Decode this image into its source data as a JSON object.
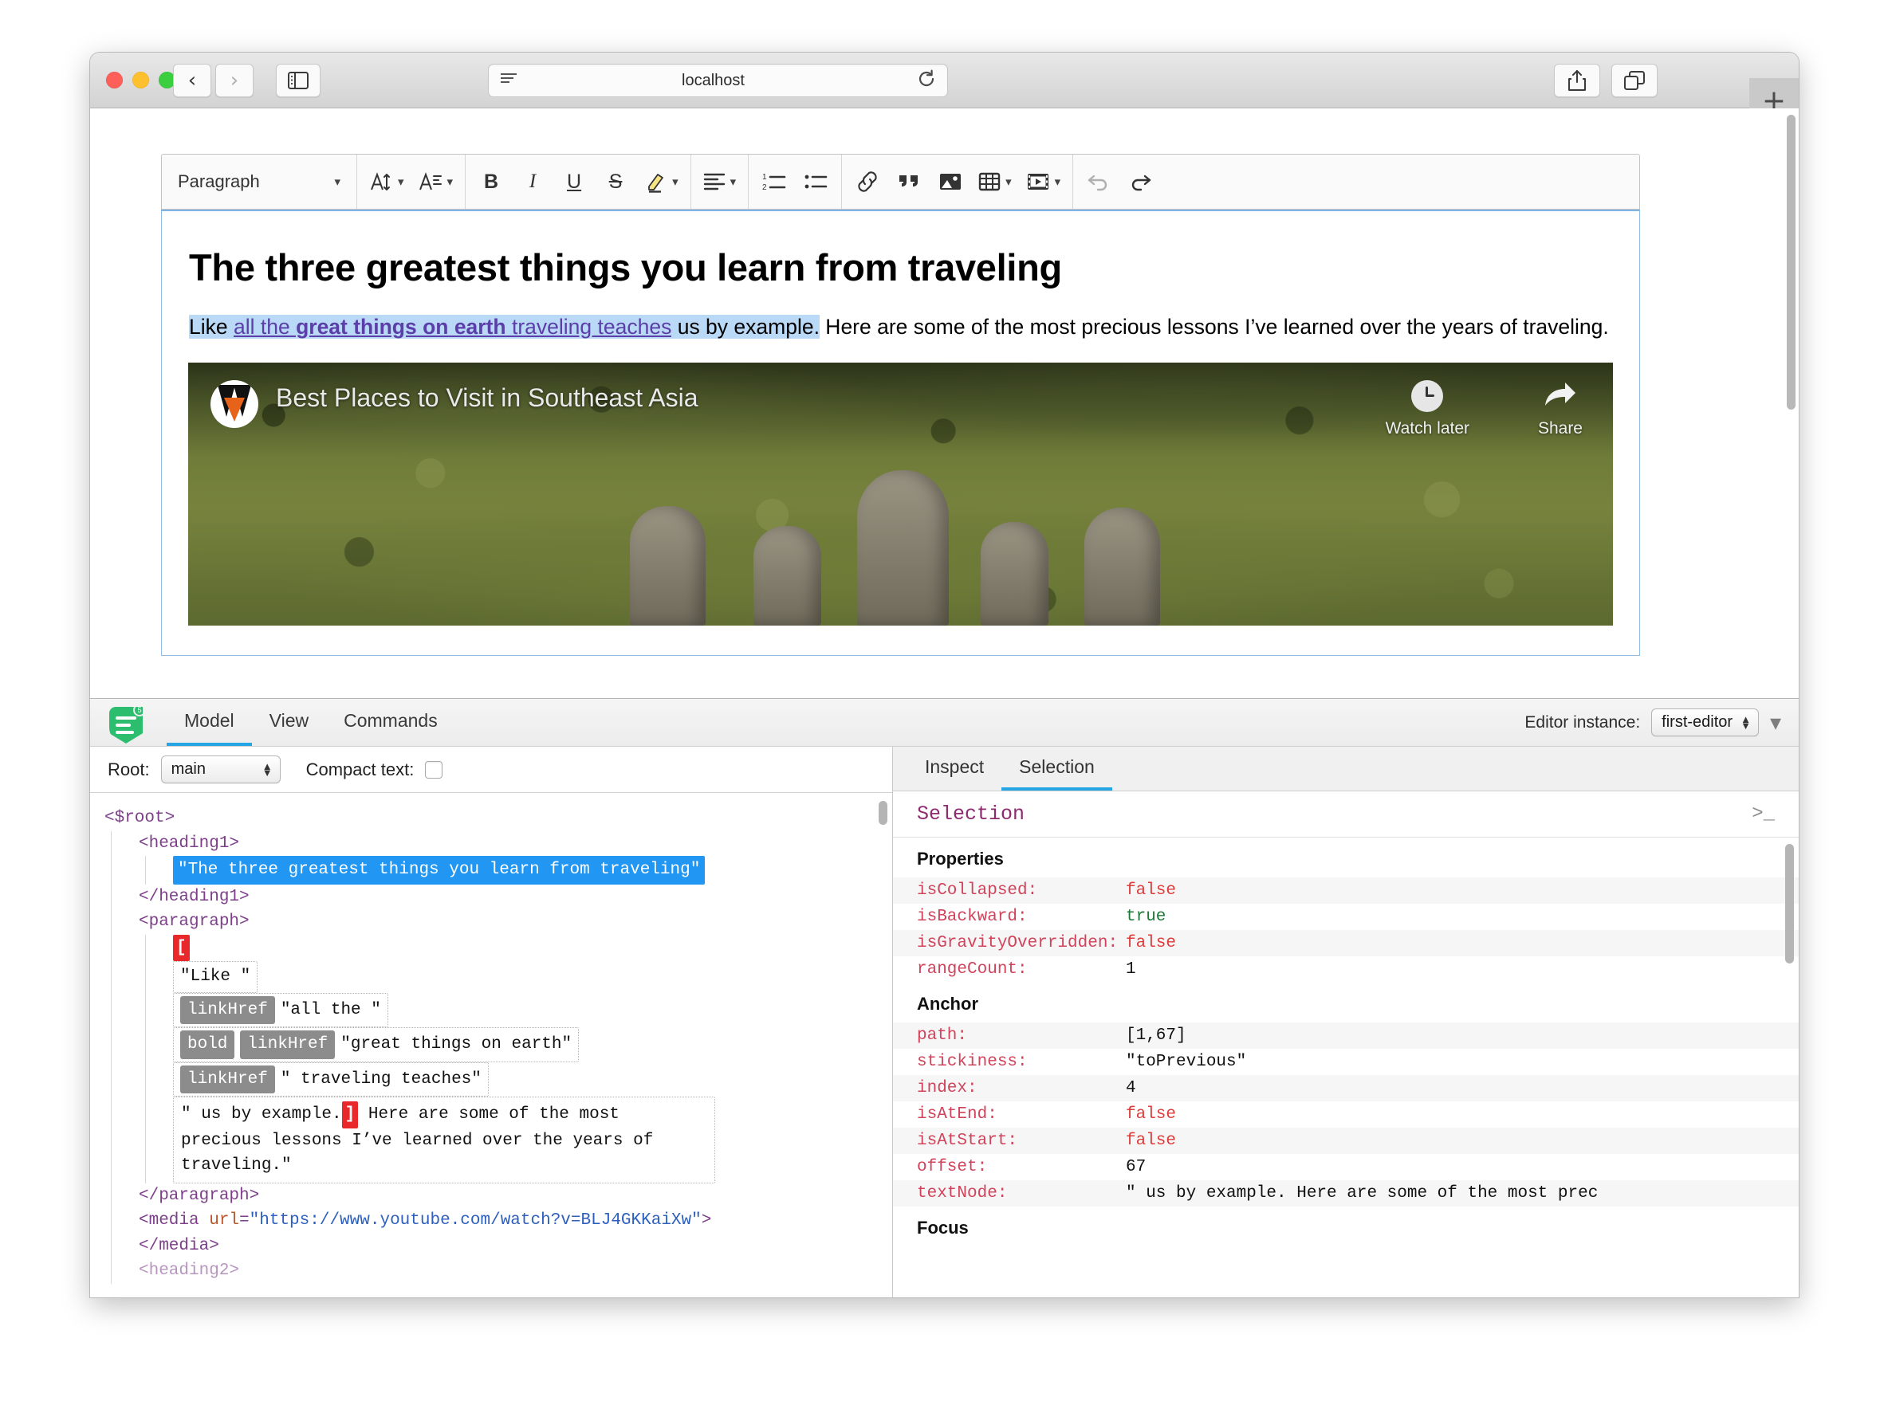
{
  "browser": {
    "url_text": "localhost",
    "back_icon": "chevron-left-icon",
    "forward_icon": "chevron-right-icon",
    "sidebar_icon": "sidebar-icon",
    "reader_icon": "reader-view-icon",
    "reload_icon": "reload-icon",
    "share_icon": "share-icon",
    "tabs_icon": "tab-overview-icon",
    "new_tab_label": "+"
  },
  "editor": {
    "toolbar": {
      "paragraph_label": "Paragraph",
      "font_size_icon": "font-size-icon",
      "font_family_icon": "font-family-icon",
      "bold_label": "B",
      "italic_label": "I",
      "underline_label": "U",
      "strikethrough_label": "S",
      "highlight_icon": "highlight-pen-icon",
      "align_icon": "align-icon",
      "numbered_list_icon": "numbered-list-icon",
      "bulleted_list_icon": "bulleted-list-icon",
      "link_icon": "link-icon",
      "blockquote_icon": "blockquote-icon",
      "image_icon": "image-icon",
      "table_icon": "table-icon",
      "media_icon": "media-embed-icon",
      "undo_icon": "undo-icon",
      "redo_icon": "redo-icon"
    },
    "document": {
      "heading": "The three greatest things you learn from traveling",
      "p_like": "Like ",
      "p_link1": "all the ",
      "p_link_bold": "great things on earth",
      "p_link2": " traveling teaches",
      "p_tail_sel": " us by example.",
      "p_rest": " Here are some of the most precious lessons I’ve learned over the years of traveling."
    },
    "video": {
      "title": "Best Places to Visit in Southeast Asia",
      "watch_later": "Watch later",
      "share": "Share",
      "logo_icon": "youtube-channel-avatar-icon",
      "clock_icon": "clock-icon",
      "share_arrow_icon": "share-arrow-icon"
    }
  },
  "inspector": {
    "logo_icon": "ckeditor-inspector-logo-icon",
    "logo_badge": "5",
    "tabs": [
      {
        "label": "Model",
        "active": true
      },
      {
        "label": "View",
        "active": false
      },
      {
        "label": "Commands",
        "active": false
      }
    ],
    "editor_instance_label": "Editor instance:",
    "editor_instance_value": "first-editor",
    "collapse_icon": "chevron-down-icon",
    "left": {
      "root_label": "Root:",
      "root_value": "main",
      "compact_text_label": "Compact text:",
      "compact_text_checked": false,
      "tree": {
        "root_open": "<$root>",
        "heading1_open": "<heading1>",
        "heading1_text": "\"The three greatest things you learn from traveling\"",
        "heading1_close": "</heading1>",
        "paragraph_open": "<paragraph>",
        "caret_start": "[",
        "node_like": "\"Like \"",
        "chip_linkhref": "linkHref",
        "node_all_the": "\"all the \"",
        "chip_bold": "bold",
        "node_great_things": "\"great things on earth\"",
        "node_traveling_teaches": "\" traveling teaches\"",
        "node_tail_a": "\" us by example.",
        "caret_end": "]",
        "node_tail_b": " Here are some of the most precious lessons I’ve learned over the years of traveling.\"",
        "paragraph_close": "</paragraph>",
        "media_open_a": "<media ",
        "media_attr_name": "url",
        "media_attr_eq": "=",
        "media_attr_value": "\"https://www.youtube.com/watch?v=BLJ4GKKaiXw\"",
        "media_open_b": ">",
        "media_close": "</media>",
        "heading2_open": "<heading2>"
      }
    },
    "right": {
      "tabs": [
        {
          "label": "Inspect",
          "active": false
        },
        {
          "label": "Selection",
          "active": true
        }
      ],
      "panel_title": "Selection",
      "console_icon": "terminal-icon",
      "sections": [
        {
          "title": "Properties",
          "rows": [
            {
              "key": "isCollapsed:",
              "value": "false",
              "kind": "false"
            },
            {
              "key": "isBackward:",
              "value": "true",
              "kind": "true"
            },
            {
              "key": "isGravityOverridden:",
              "value": "false",
              "kind": "false"
            },
            {
              "key": "rangeCount:",
              "value": "1",
              "kind": "plain"
            }
          ]
        },
        {
          "title": "Anchor",
          "rows": [
            {
              "key": "path:",
              "value": "[1,67]",
              "kind": "plain"
            },
            {
              "key": "stickiness:",
              "value": "\"toPrevious\"",
              "kind": "plain"
            },
            {
              "key": "index:",
              "value": "4",
              "kind": "plain"
            },
            {
              "key": "isAtEnd:",
              "value": "false",
              "kind": "false"
            },
            {
              "key": "isAtStart:",
              "value": "false",
              "kind": "false"
            },
            {
              "key": "offset:",
              "value": "67",
              "kind": "plain"
            },
            {
              "key": "textNode:",
              "value": "\" us by example. Here are some of the most prec",
              "kind": "plain"
            }
          ]
        },
        {
          "title": "Focus",
          "rows": []
        }
      ]
    }
  }
}
